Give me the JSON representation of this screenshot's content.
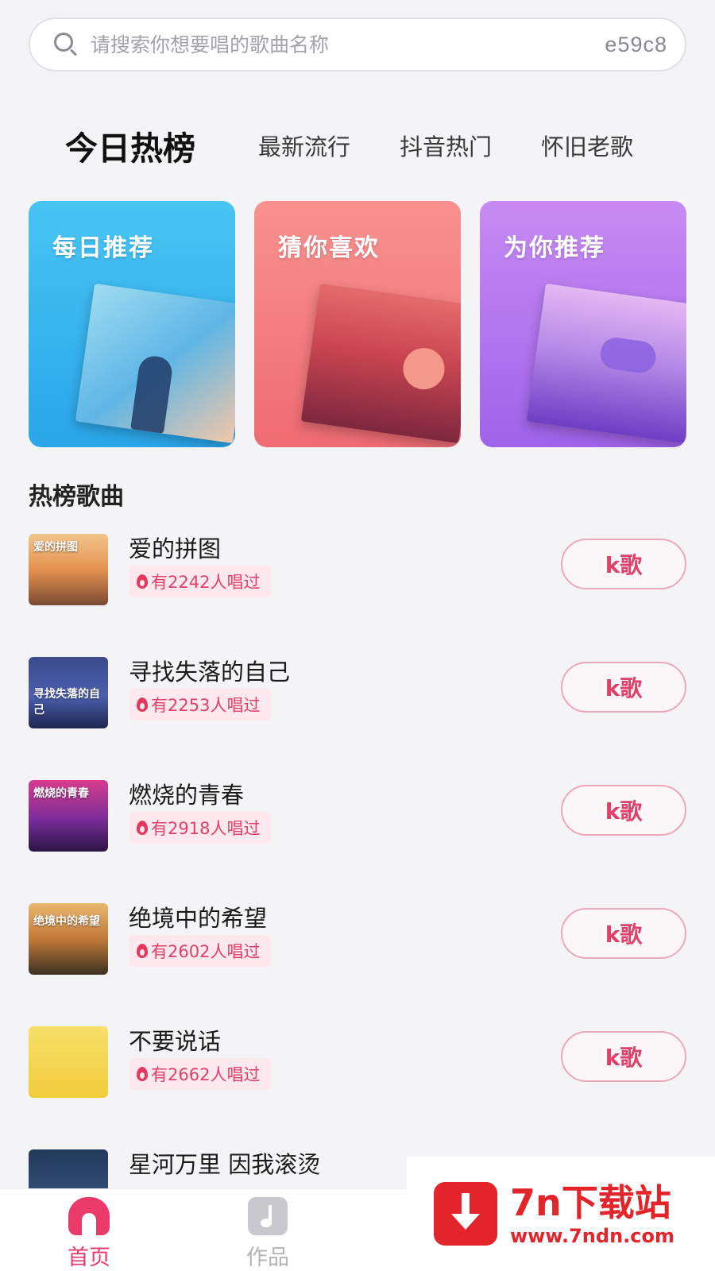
{
  "search": {
    "placeholder": "请搜索你想要唱的歌曲名称",
    "code": "e59c8"
  },
  "tabs": [
    {
      "label": "今日热榜",
      "active": true
    },
    {
      "label": "最新流行",
      "active": false
    },
    {
      "label": "抖音热门",
      "active": false
    },
    {
      "label": "怀旧老歌",
      "active": false
    }
  ],
  "cards": [
    {
      "title": "每日推荐"
    },
    {
      "title": "猜你喜欢"
    },
    {
      "title": "为你推荐"
    }
  ],
  "section_title": "热榜歌曲",
  "songs": [
    {
      "title": "爱的拼图",
      "cover_text": "爱的拼图",
      "sung": "有2242人唱过",
      "button": "k歌"
    },
    {
      "title": "寻找失落的自己",
      "cover_text": "寻找失落的自己",
      "sung": "有2253人唱过",
      "button": "k歌"
    },
    {
      "title": "燃烧的青春",
      "cover_text": "燃烧的青春",
      "sung": "有2918人唱过",
      "button": "k歌"
    },
    {
      "title": "绝境中的希望",
      "cover_text": "绝境中的希望",
      "sung": "有2602人唱过",
      "button": "k歌"
    },
    {
      "title": "不要说话",
      "cover_text": "",
      "sung": "有2662人唱过",
      "button": "k歌"
    },
    {
      "title": "星河万里 因我滚烫",
      "cover_text": "",
      "sung": "",
      "button": ""
    }
  ],
  "nav": {
    "home": "首页",
    "works": "作品"
  },
  "watermark": {
    "name": "7n下载站",
    "url": "www.7ndn.com"
  },
  "colors": {
    "accent": "#ea3a6a",
    "background": "#f4f3f6"
  }
}
